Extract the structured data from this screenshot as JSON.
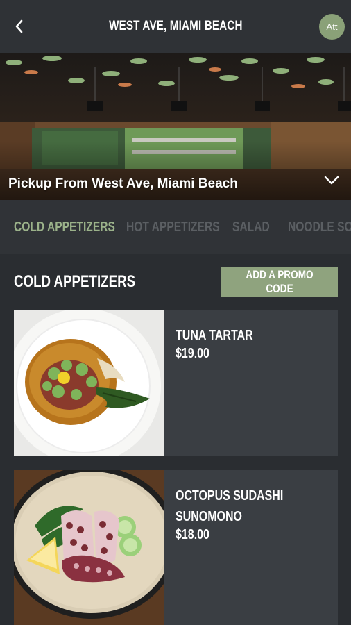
{
  "header": {
    "title": "WEST AVE, MIAMI BEACH",
    "avatar_text": "Att"
  },
  "hero": {
    "caption": "Pickup From West Ave, Miami Beach"
  },
  "tabs": [
    {
      "label": "COLD APPETIZERS",
      "active": true
    },
    {
      "label": "HOT APPETIZERS",
      "active": false
    },
    {
      "label": "SALAD",
      "active": false
    },
    {
      "label": "NOODLE SOUP",
      "active": false
    }
  ],
  "section": {
    "title": "COLD APPETIZERS",
    "promo_label": "ADD A PROMO CODE"
  },
  "menu_items": [
    {
      "name": "TUNA TARTAR",
      "price": "$19.00"
    },
    {
      "name_line1": "OCTOPUS SUDASHI",
      "name_line2": "SUNOMONO",
      "price": "$18.00"
    }
  ],
  "colors": {
    "accent": "#8fa37e",
    "active_tab": "#9bb28a",
    "background": "#303337",
    "card": "#3a3e43"
  }
}
